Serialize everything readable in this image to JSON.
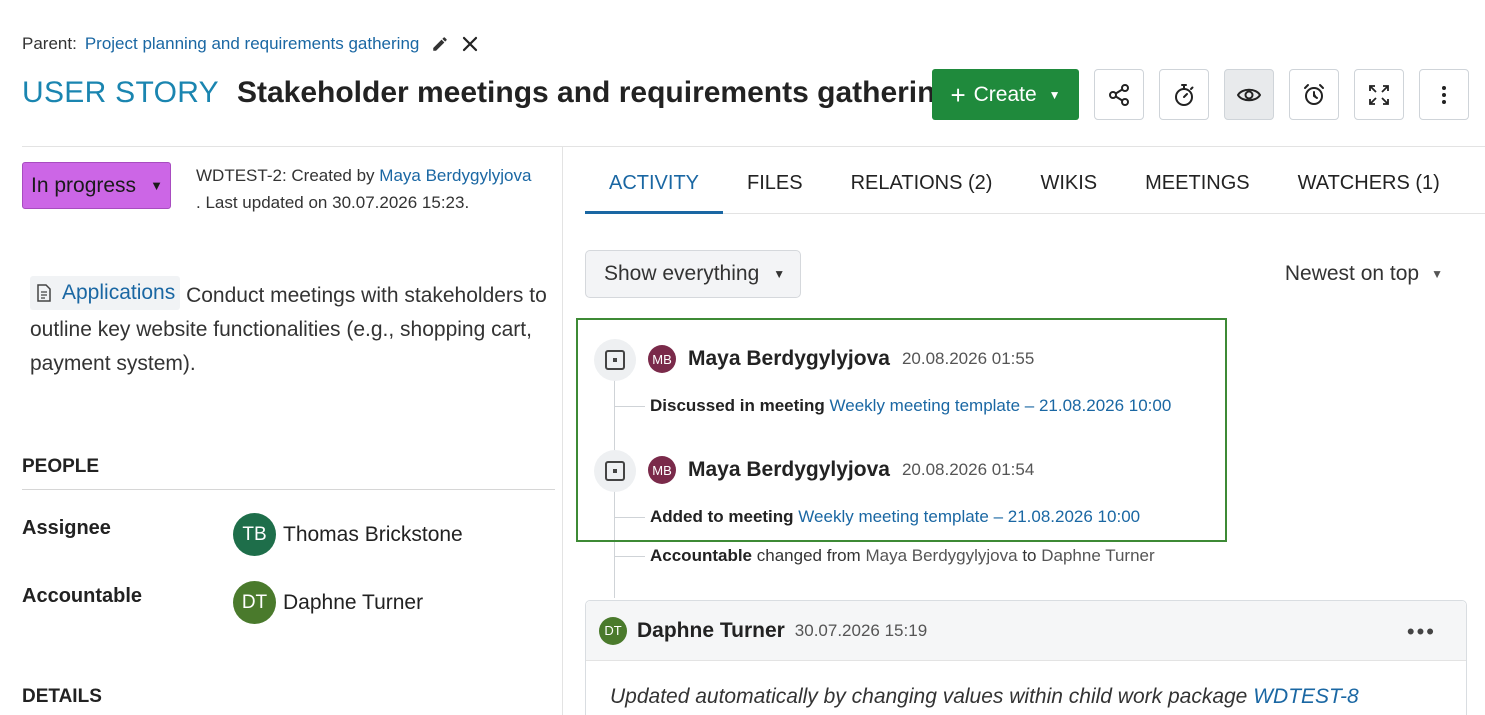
{
  "header": {
    "parent_label": "Parent:",
    "parent_link": "Project planning and requirements gathering",
    "type_label": "USER STORY",
    "subject": "Stakeholder meetings and requirements gathering",
    "create_label": "Create"
  },
  "status": {
    "label": "In progress",
    "color": "#cc66e6"
  },
  "meta": {
    "prefix": "WDTEST-2: Created by",
    "author": "Maya Berdygylyjova",
    "updated": ". Last updated on 30.07.2026 15:23."
  },
  "description": {
    "chip_label": "Applications",
    "text": "Conduct meetings with stakeholders to outline key website functionalities (e.g., shopping cart, payment system)."
  },
  "people": {
    "section_title": "PEOPLE",
    "assignee_label": "Assignee",
    "assignee_initials": "TB",
    "assignee_name": "Thomas Brickstone",
    "accountable_label": "Accountable",
    "accountable_initials": "DT",
    "accountable_name": "Daphne Turner"
  },
  "details_title": "DETAILS",
  "tabs": [
    {
      "label": "ACTIVITY",
      "active": true
    },
    {
      "label": "FILES",
      "active": false
    },
    {
      "label": "RELATIONS (2)",
      "active": false
    },
    {
      "label": "WIKIS",
      "active": false
    },
    {
      "label": "MEETINGS",
      "active": false
    },
    {
      "label": "WATCHERS (1)",
      "active": false
    }
  ],
  "filter": {
    "label": "Show everything",
    "sort_label": "Newest on top"
  },
  "activity": [
    {
      "initials": "MB",
      "name": "Maya Berdygylyjova",
      "date": "20.08.2026 01:55",
      "detail_bold": "Discussed in meeting",
      "detail_link": "Weekly meeting template – 21.08.2026 10:00"
    },
    {
      "initials": "MB",
      "name": "Maya Berdygylyjova",
      "date": "20.08.2026 01:54",
      "detail_bold": "Added to meeting",
      "detail_link": "Weekly meeting template – 21.08.2026 10:00",
      "extra_bold": "Accountable",
      "extra_mid": "changed from",
      "extra_from": "Maya Berdygylyjova",
      "extra_to_word": "to",
      "extra_to": "Daphne Turner"
    }
  ],
  "comment": {
    "initials": "DT",
    "name": "Daphne Turner",
    "date": "30.07.2026 15:19",
    "text": "Updated automatically by changing values within child work package",
    "link": "WDTEST-8"
  },
  "colors": {
    "accent": "#1a67a3",
    "type_label": "#1a85b0",
    "create_button": "#1f8a3c",
    "highlight_border": "#3d8a35"
  },
  "icons": [
    "pencil-icon",
    "close-icon",
    "plus-icon",
    "share-icon",
    "stopwatch-icon",
    "eye-icon",
    "alarm-icon",
    "fullscreen-icon",
    "more-vertical-icon",
    "document-icon",
    "activity-item-icon",
    "more-horizontal-icon"
  ]
}
